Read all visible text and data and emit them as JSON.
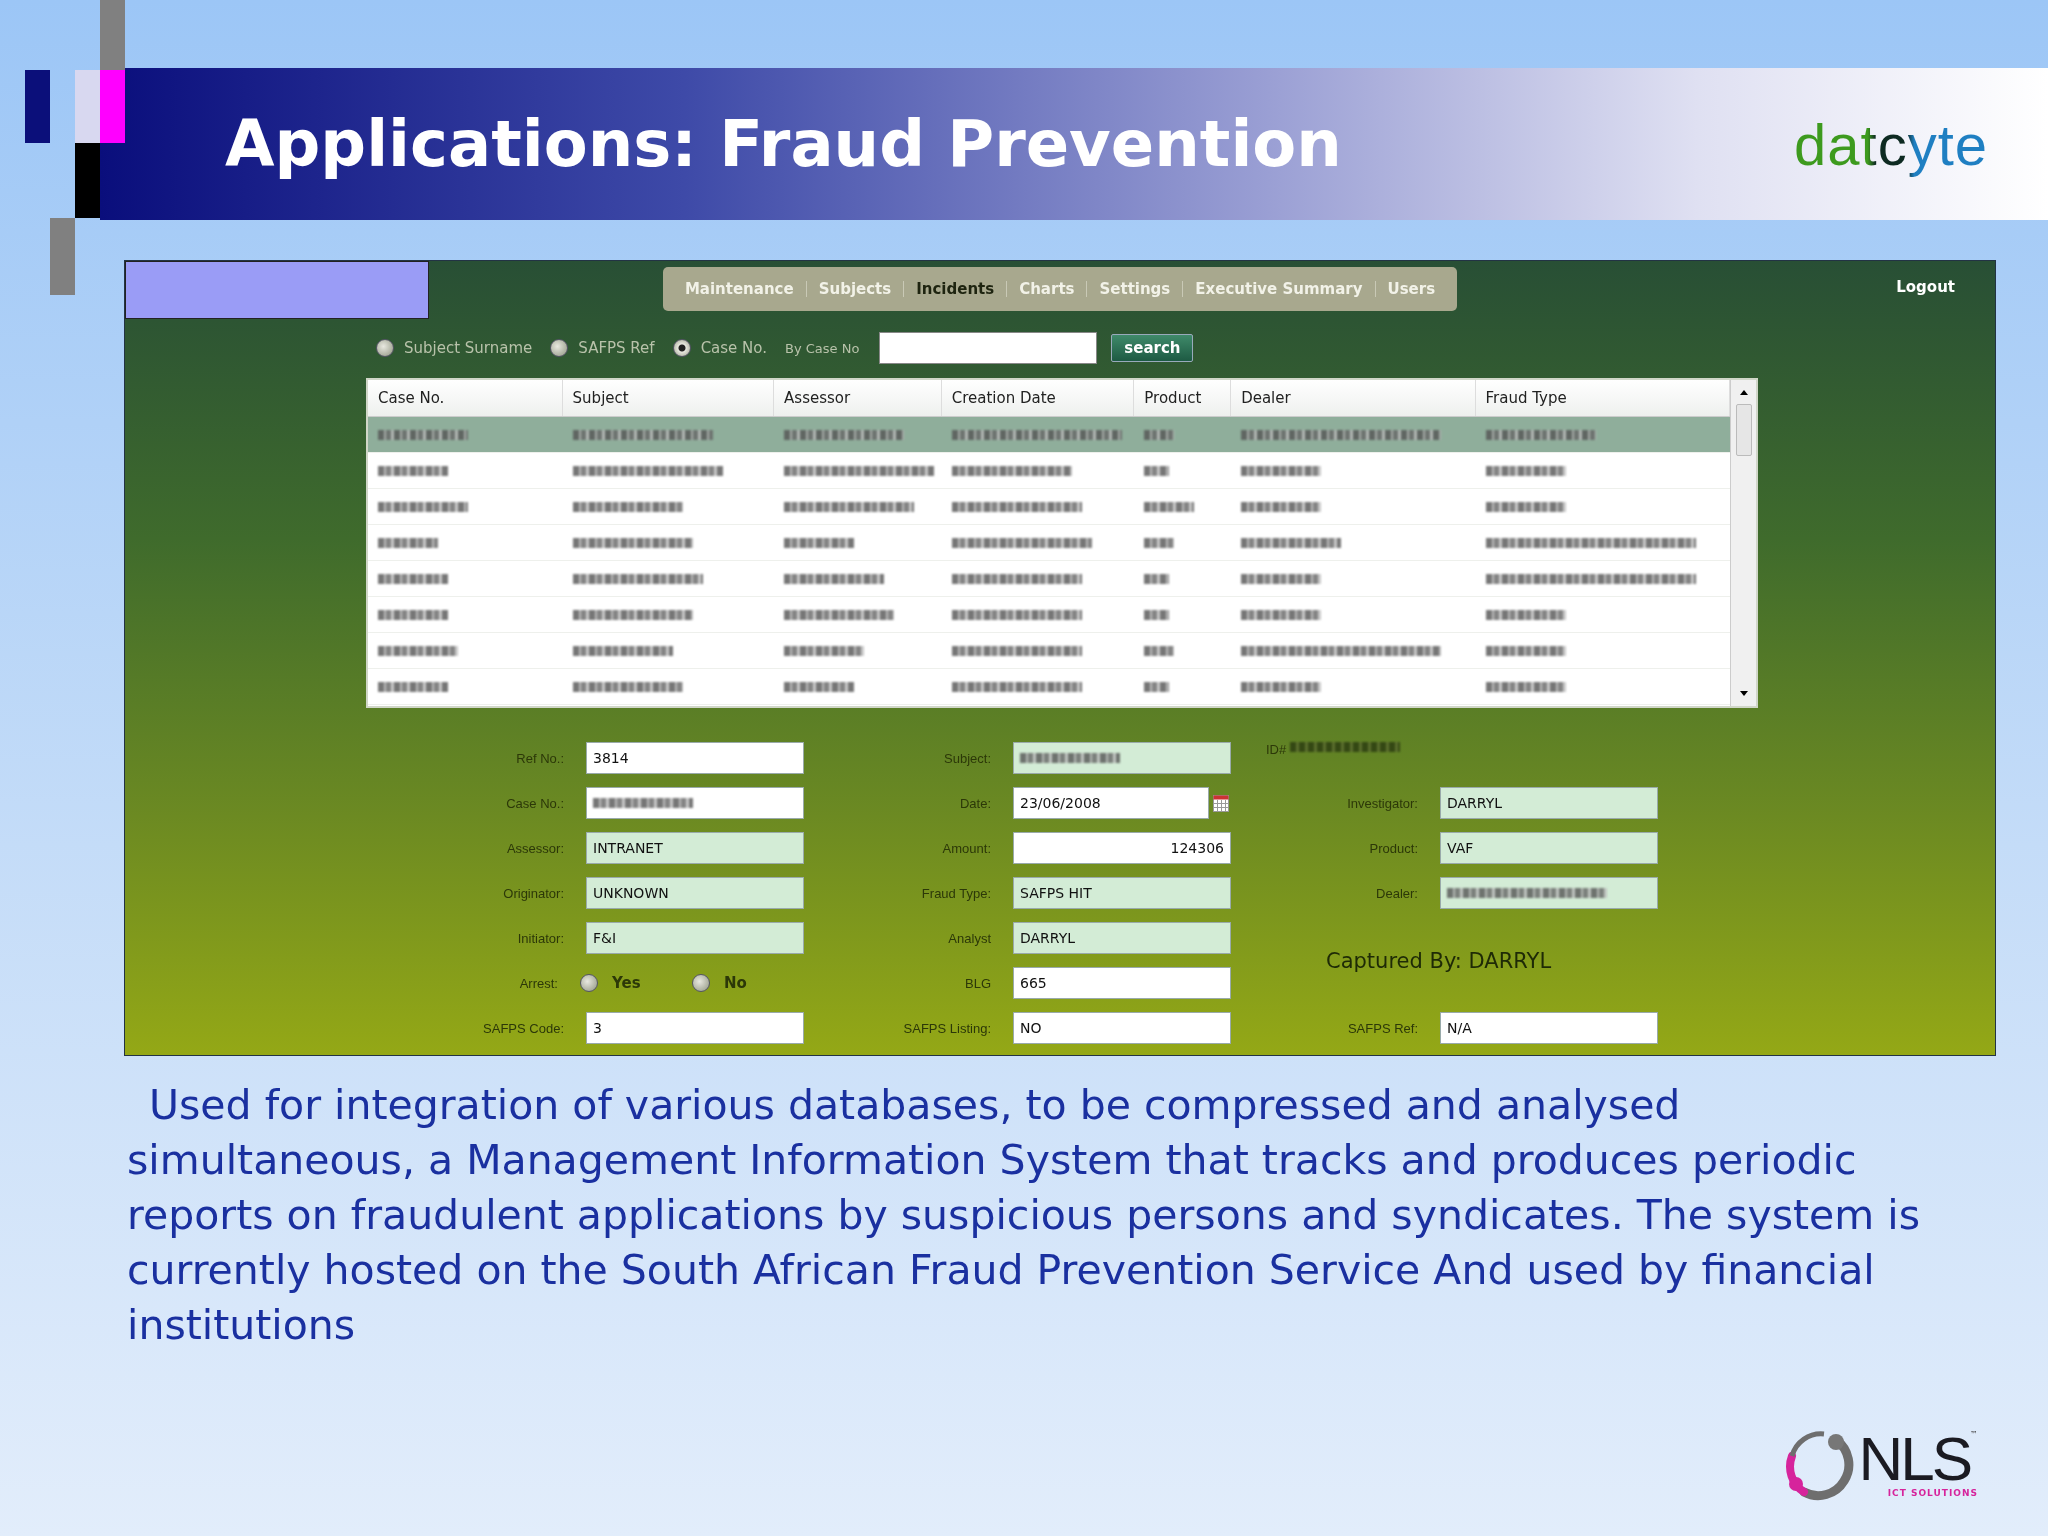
{
  "slide": {
    "title": "Applications: Fraud Prevention",
    "logo": "datcyte"
  },
  "app": {
    "nav": [
      {
        "label": "Maintenance",
        "selected": false
      },
      {
        "label": "Subjects",
        "selected": false
      },
      {
        "label": "Incidents",
        "selected": true
      },
      {
        "label": "Charts",
        "selected": false
      },
      {
        "label": "Settings",
        "selected": false
      },
      {
        "label": "Executive Summary",
        "selected": false
      },
      {
        "label": "Users",
        "selected": false
      }
    ],
    "logout": "Logout",
    "search": {
      "options": [
        {
          "label": "Subject Surname",
          "selected": false
        },
        {
          "label": "SAFPS Ref",
          "selected": false
        },
        {
          "label": "Case No.",
          "selected": true
        }
      ],
      "field_label": "By Case No",
      "button": "search"
    },
    "table": {
      "columns": [
        "Case No.",
        "Subject",
        "Assessor",
        "Creation Date",
        "Product",
        "Dealer",
        "Fraud Type"
      ],
      "rows": [
        {
          "selected": true
        },
        {
          "selected": false
        },
        {
          "selected": false
        },
        {
          "selected": false
        },
        {
          "selected": false
        },
        {
          "selected": false
        },
        {
          "selected": false
        },
        {
          "selected": false
        }
      ]
    },
    "form": {
      "columns": [
        [
          {
            "kind": "input",
            "label": "Ref No.:",
            "value": "3814"
          },
          {
            "kind": "input",
            "label": "Case No.:",
            "blurred": true
          },
          {
            "kind": "readonly",
            "label": "Assessor:",
            "value": "INTRANET"
          },
          {
            "kind": "readonly",
            "label": "Originator:",
            "value": "UNKNOWN"
          },
          {
            "kind": "readonly",
            "label": "Initiator:",
            "value": "F&I"
          },
          {
            "kind": "radio",
            "label": "Arrest:",
            "options": [
              {
                "label": "Yes",
                "selected": false
              },
              {
                "label": "No",
                "selected": false
              }
            ]
          },
          {
            "kind": "input",
            "label": "SAFPS Code:",
            "value": "3"
          }
        ],
        [
          {
            "kind": "readonly",
            "label": "Subject:",
            "blurred": true
          },
          {
            "kind": "date",
            "label": "Date:",
            "value": "23/06/2008"
          },
          {
            "kind": "number",
            "label": "Amount:",
            "value": "124306"
          },
          {
            "kind": "readonly",
            "label": "Fraud Type:",
            "value": "SAFPS HIT"
          },
          {
            "kind": "readonly",
            "label": "Analyst",
            "value": "DARRYL"
          },
          {
            "kind": "input",
            "label": "BLG",
            "value": "665"
          },
          {
            "kind": "input",
            "label": "SAFPS Listing:",
            "value": "NO"
          }
        ],
        [
          {
            "kind": "id",
            "label": "ID#",
            "blurred": true
          },
          {
            "kind": "readonly",
            "label": "Investigator:",
            "value": "DARRYL"
          },
          {
            "kind": "readonly",
            "label": "Product:",
            "value": "VAF"
          },
          {
            "kind": "readonly",
            "label": "Dealer:",
            "blurred": true
          },
          {
            "kind": "note",
            "text": "Captured By: DARRYL"
          },
          {
            "kind": "input",
            "label": "SAFPS Ref:",
            "value": "N/A"
          }
        ]
      ]
    }
  },
  "description": "Used for integration of various databases, to be compressed and analysed simultaneous, a Management Information System that tracks and produces periodic reports on fraudulent applications by suspicious persons and syndicates. The system is currently hosted on the South African Fraud Prevention Service And used by financial institutions",
  "footer_logo": {
    "name": "NLS",
    "trademark": "™",
    "tagline": "ICT SOLUTIONS"
  }
}
